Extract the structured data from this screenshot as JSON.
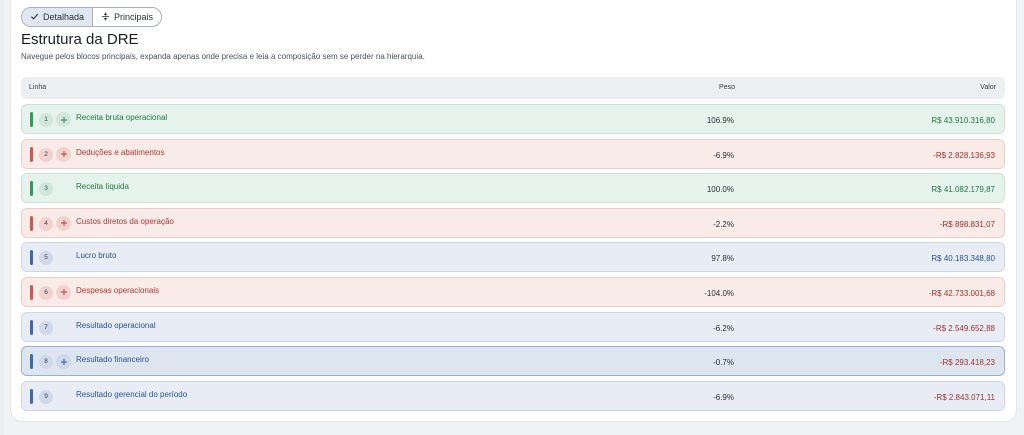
{
  "view_toggle": {
    "detailed_label": "Detalhada",
    "main_label": "Principais"
  },
  "header": {
    "title": "Estrutura da DRE",
    "subtitle": "Navegue pelos blocos principais, expanda apenas onde precisa e leia a composição sem se perder na hierarquia."
  },
  "table": {
    "columns": {
      "line": "Linha",
      "weight": "Peso",
      "value": "Valor"
    },
    "rows": [
      {
        "num": "1",
        "label": "Receita bruta operacional",
        "peso": "106.9%",
        "valor": "R$ 43.910.316,80"
      },
      {
        "num": "2",
        "label": "Deduções e abatimentos",
        "peso": "-6.9%",
        "valor": "-R$ 2.828.136,93"
      },
      {
        "num": "3",
        "label": "Receita líquida",
        "peso": "100.0%",
        "valor": "R$ 41.082.179,87"
      },
      {
        "num": "4",
        "label": "Custos diretos da operação",
        "peso": "-2.2%",
        "valor": "-R$ 898.831,07"
      },
      {
        "num": "5",
        "label": "Lucro bruto",
        "peso": "97.8%",
        "valor": "R$ 40.183.348,80"
      },
      {
        "num": "6",
        "label": "Despesas operacionais",
        "peso": "-104.0%",
        "valor": "-R$ 42.733.001,68"
      },
      {
        "num": "7",
        "label": "Resultado operacional",
        "peso": "-6.2%",
        "valor": "-R$ 2.549.652,88"
      },
      {
        "num": "8",
        "label": "Resultado financeiro",
        "peso": "-0.7%",
        "valor": "-R$ 293.418,23"
      },
      {
        "num": "9",
        "label": "Resultado gerencial do período",
        "peso": "-6.9%",
        "valor": "-R$ 2.843.071,11"
      }
    ]
  },
  "colors": {
    "positive": "#1f7a45",
    "negative": "#b3392c",
    "result": "#2b5296"
  }
}
